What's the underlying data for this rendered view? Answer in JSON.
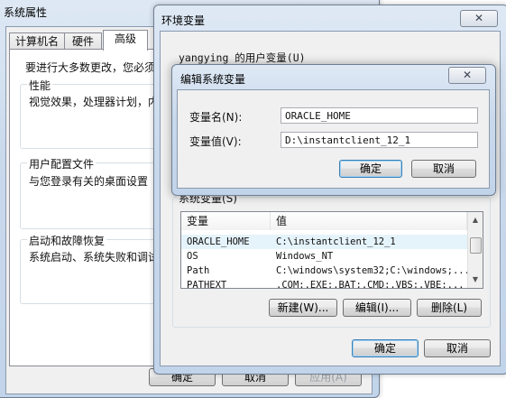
{
  "sys_props": {
    "title": "系统属性",
    "tabs": [
      "计算机名",
      "硬件",
      "高级"
    ],
    "intro": "要进行大多数更改，您必须",
    "perf_group": "性能",
    "perf_desc": "视觉效果，处理器计划，内",
    "profile_group": "用户配置文件",
    "profile_desc": "与您登录有关的桌面设置",
    "startup_group": "启动和故障恢复",
    "startup_desc": "系统启动、系统失败和调试",
    "ok": "确定",
    "cancel": "取消",
    "apply": "应用(A)"
  },
  "env_vars": {
    "title": "环境变量",
    "close": "✕",
    "user_vars_label": "yangying 的用户变量(U)",
    "sys_vars_label": "系统变量(S)",
    "col_var": "变量",
    "col_value": "值",
    "rows": [
      {
        "name": "ORACLE_HOME",
        "value": "C:\\instantclient_12_1"
      },
      {
        "name": "OS",
        "value": "Windows_NT"
      },
      {
        "name": "Path",
        "value": "C:\\windows\\system32;C:\\windows;..."
      },
      {
        "name": "PATHEXT",
        "value": ".COM;.EXE;.BAT;.CMD;.VBS;.VBE;..."
      }
    ],
    "new_btn": "新建(W)...",
    "edit_btn": "编辑(I)...",
    "delete_btn": "删除(L)",
    "ok": "确定",
    "cancel": "取消"
  },
  "edit_dialog": {
    "title": "编辑系统变量",
    "close": "✕",
    "name_label": "变量名(N):",
    "name_value": "ORACLE_HOME",
    "value_label": "变量值(V):",
    "value_value": "D:\\instantclient_12_1",
    "ok": "确定",
    "cancel": "取消"
  }
}
